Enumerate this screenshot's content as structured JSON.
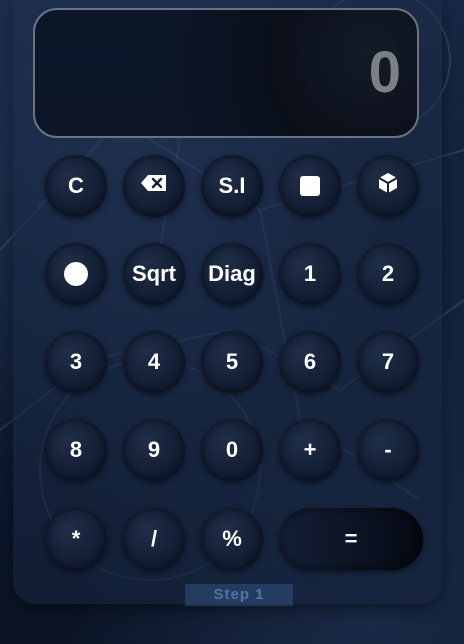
{
  "display": {
    "value": "0"
  },
  "buttons": {
    "clear": "C",
    "backspace_icon": "backspace-icon",
    "si": "S.I",
    "square_icon": "square-icon",
    "cube_icon": "cube-icon",
    "circle_icon": "circle-icon",
    "sqrt": "Sqrt",
    "diag": "Diag",
    "one": "1",
    "two": "2",
    "three": "3",
    "four": "4",
    "five": "5",
    "six": "6",
    "seven": "7",
    "eight": "8",
    "nine": "9",
    "zero": "0",
    "plus": "+",
    "minus": "-",
    "multiply": "*",
    "divide": "/",
    "percent": "%",
    "equals": "="
  },
  "background": {
    "step_label": "Step 1"
  },
  "colors": {
    "display_text": "#7b7f86",
    "button_text": "#ffffff",
    "background": "#14223b"
  }
}
